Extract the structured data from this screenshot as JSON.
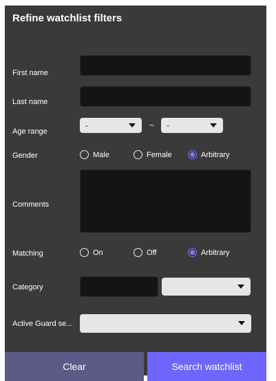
{
  "title": "Refine watchlist filters",
  "labels": {
    "first_name": "First name",
    "last_name": "Last name",
    "age_range": "Age range",
    "gender": "Gender",
    "comments": "Comments",
    "matching": "Matching",
    "category": "Category",
    "active_guard": "Active Guard se..."
  },
  "age": {
    "from": "-",
    "to": "-",
    "separator": "~"
  },
  "gender_options": [
    "Male",
    "Female",
    "Arbitrary"
  ],
  "gender_selected": "Arbitrary",
  "matching_options": [
    "On",
    "Off",
    "Arbitrary"
  ],
  "matching_selected": "Arbitrary",
  "buttons": {
    "clear": "Clear",
    "search": "Search watchlist"
  },
  "colors": {
    "panel": "#3a3a3a",
    "field": "#141414",
    "accent": "#6f66ff",
    "clear": "#5c5a86"
  }
}
